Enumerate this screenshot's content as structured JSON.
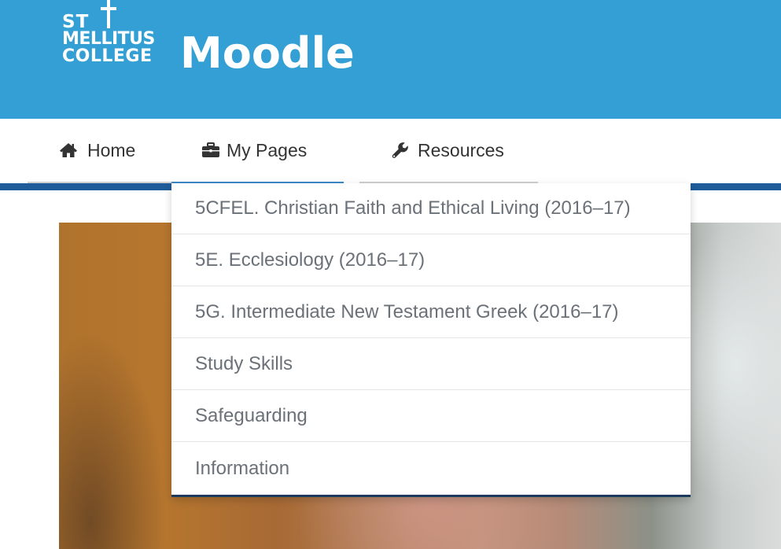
{
  "header": {
    "logo_line_1": "ST",
    "logo_line_2": "MELLITUS",
    "logo_line_3": "COLLEGE",
    "app_name": "Moodle",
    "background_color": "#339fd4"
  },
  "nav": {
    "items": [
      {
        "label": "Home",
        "icon": "home-icon"
      },
      {
        "label": "My Pages",
        "icon": "briefcase-icon",
        "active": true
      },
      {
        "label": "Resources",
        "icon": "wrench-icon"
      }
    ],
    "rule_color": "#1f5c99"
  },
  "dropdown": {
    "items": [
      {
        "label": "5CFEL. Christian Faith and Ethical Living (2016–17)"
      },
      {
        "label": "5E. Ecclesiology (2016–17)"
      },
      {
        "label": "5G. Intermediate New Testament Greek (2016–17)"
      },
      {
        "label": "Study Skills"
      },
      {
        "label": "Safeguarding"
      },
      {
        "label": "Information"
      }
    ]
  }
}
